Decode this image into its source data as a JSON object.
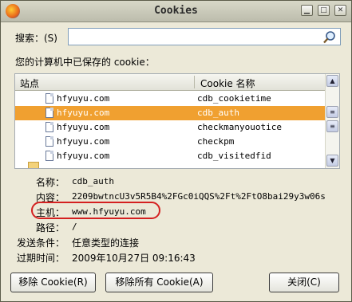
{
  "window": {
    "title": "Cookies",
    "controls": {
      "minimize": "▁",
      "maximize": "□",
      "close": "✕"
    }
  },
  "search": {
    "label": "搜索：(S)",
    "value": "",
    "icon": "magnifier-icon"
  },
  "saved_label": "您的计算机中已保存的 cookie：",
  "list": {
    "columns": [
      "站点",
      "Cookie 名称"
    ],
    "rows": [
      {
        "host": "hfyuyu.com",
        "name": "cdb_cookietime",
        "selected": false
      },
      {
        "host": "hfyuyu.com",
        "name": "cdb_auth",
        "selected": true
      },
      {
        "host": "hfyuyu.com",
        "name": "checkmanyouotice",
        "selected": false
      },
      {
        "host": "hfyuyu.com",
        "name": "checkpm",
        "selected": false
      },
      {
        "host": "hfyuyu.com",
        "name": "cdb_visitedfid",
        "selected": false
      }
    ]
  },
  "details": {
    "name_label": "名称：",
    "name_value": "cdb_auth",
    "content_label": "内容：",
    "content_value": "2209bwtncU3v5R5B4%2FGc0iQQS%2Ft%2FtO8bai29y3w06s",
    "host_label": "主机：",
    "host_value": "www.hfyuyu.com",
    "path_label": "路径：",
    "path_value": "/",
    "send_label": "发送条件：",
    "send_value": "任意类型的连接",
    "expires_label": "过期时间：",
    "expires_value": "2009年10月27日 09:16:43"
  },
  "buttons": {
    "remove": "移除 Cookie(R)",
    "remove_all": "移除所有 Cookie(A)",
    "close": "关闭(C)"
  },
  "colors": {
    "selection": "#f0a030",
    "annotation": "#d42020"
  }
}
